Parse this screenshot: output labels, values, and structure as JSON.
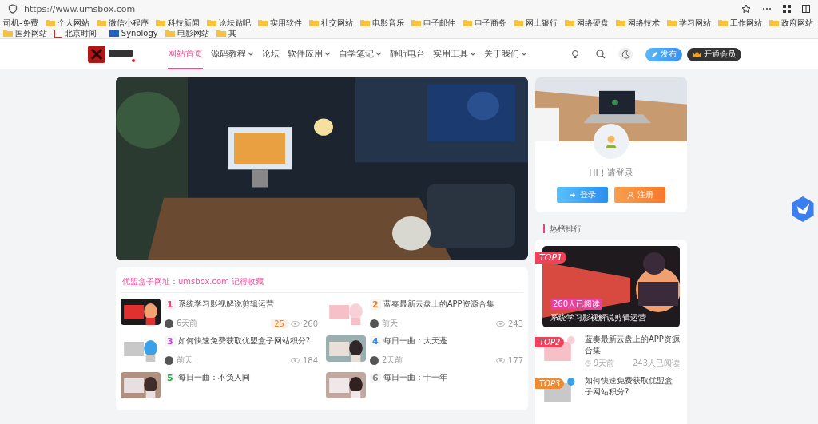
{
  "browser": {
    "url": "https://www.umsbox.com"
  },
  "bookmarks": [
    {
      "label": "司机-免费",
      "kind": "plain"
    },
    {
      "label": "个人网站",
      "kind": "folder"
    },
    {
      "label": "微信小程序",
      "kind": "folder"
    },
    {
      "label": "科技新闻",
      "kind": "folder"
    },
    {
      "label": "论坛贴吧",
      "kind": "folder"
    },
    {
      "label": "实用软件",
      "kind": "folder"
    },
    {
      "label": "社交网站",
      "kind": "folder"
    },
    {
      "label": "电影音乐",
      "kind": "folder"
    },
    {
      "label": "电子邮件",
      "kind": "folder"
    },
    {
      "label": "电子商务",
      "kind": "folder"
    },
    {
      "label": "网上银行",
      "kind": "folder"
    },
    {
      "label": "网络硬盘",
      "kind": "folder"
    },
    {
      "label": "网络技术",
      "kind": "folder"
    },
    {
      "label": "学习网站",
      "kind": "folder"
    },
    {
      "label": "工作网站",
      "kind": "folder"
    },
    {
      "label": "政府网站",
      "kind": "folder"
    },
    {
      "label": "国外网站",
      "kind": "folder"
    },
    {
      "label": "北京时间 -",
      "kind": "page"
    },
    {
      "label": "Synology",
      "kind": "site"
    },
    {
      "label": "电影网站",
      "kind": "folder"
    },
    {
      "label": "其",
      "kind": "folder"
    }
  ],
  "nav": {
    "items": [
      {
        "label": "网站首页",
        "selected": true,
        "dropdown": false
      },
      {
        "label": "源码教程",
        "selected": false,
        "dropdown": true
      },
      {
        "label": "论坛",
        "selected": false,
        "dropdown": false
      },
      {
        "label": "软件应用",
        "selected": false,
        "dropdown": true
      },
      {
        "label": "自学笔记",
        "selected": false,
        "dropdown": true
      },
      {
        "label": "静听电台",
        "selected": false,
        "dropdown": false
      },
      {
        "label": "实用工具",
        "selected": false,
        "dropdown": true
      },
      {
        "label": "关于我们",
        "selected": false,
        "dropdown": true
      }
    ],
    "publish": "发布",
    "vip": "开通会员"
  },
  "posts_section": {
    "title": "优盟盒子网址：umsbox.com 记得收藏",
    "posts": [
      {
        "rank": "1",
        "color": "#f0407a",
        "title": "系统学习影视解说剪辑运营",
        "time": "6天前",
        "badge": "25",
        "views": "260"
      },
      {
        "rank": "2",
        "color": "#f07a20",
        "title": "蓝奏最新云盘上的APP资源合集",
        "time": "前天",
        "views": "243"
      },
      {
        "rank": "3",
        "color": "#c040e0",
        "title": "如何快速免费获取优盟盒子网站积分?",
        "time": "前天",
        "views": "184"
      },
      {
        "rank": "4",
        "color": "#3a8ef0",
        "title": "每日一曲：大天蓬",
        "time": "2天前",
        "views": "177"
      },
      {
        "rank": "5",
        "color": "#2aa84a",
        "title": "每日一曲：不负人间"
      },
      {
        "rank": "6",
        "color": "#888888",
        "title": "每日一曲：十一年"
      }
    ]
  },
  "user_card": {
    "greeting": "HI！请登录",
    "login": "登录",
    "register": "注册"
  },
  "hot": {
    "title": "热榜排行",
    "top1": {
      "tag": "TOP1",
      "reads": "260人已阅读",
      "title": "系统学习影视解说剪辑运营"
    },
    "items": [
      {
        "tag": "TOP2",
        "color": "#f0405a",
        "title": "蓝奏最新云盘上的APP资源合集",
        "time": "9天前",
        "reads": "243人已阅读"
      },
      {
        "tag": "TOP3",
        "color": "#f08a30",
        "title": "如何快速免费获取优盟盒子网站积分?"
      }
    ]
  }
}
